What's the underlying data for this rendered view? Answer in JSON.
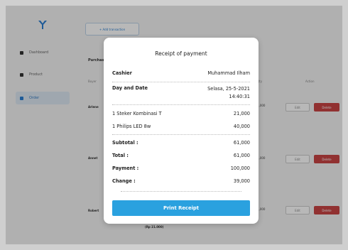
{
  "sidebar": {
    "items": [
      {
        "label": "Dashboard"
      },
      {
        "label": "Product"
      },
      {
        "label": "Order"
      }
    ]
  },
  "main": {
    "add_button": "+ Add transaction",
    "section_title": "Purchase",
    "columns": {
      "buyer": "Buyer",
      "qty": "Qty",
      "action": "Action"
    },
    "rows": [
      {
        "name": "Arlene",
        "price": "1,000"
      },
      {
        "name": "Annet",
        "price": "1,000"
      },
      {
        "name": "Robert",
        "price": "1,000"
      }
    ],
    "edit_label": "Edit",
    "delete_label": "Delete",
    "bottom_total": "(Rp 21.000)"
  },
  "receipt": {
    "title": "Receipt of payment",
    "cashier_label": "Cashier",
    "cashier_value": "Muhammad Ilham",
    "date_label": "Day and Date",
    "date_value": "Selasa, 25-5-2021",
    "time_value": "14:40:31",
    "items": [
      {
        "name": "1 Steker Kombinasi T",
        "price": "21,000"
      },
      {
        "name": "1 Philips LED 8w",
        "price": "40,000"
      }
    ],
    "subtotal_label": "Subtotal :",
    "subtotal_value": "61,000",
    "total_label": "Total :",
    "total_value": "61,000",
    "payment_label": "Payment :",
    "payment_value": "100,000",
    "change_label": "Change :",
    "change_value": "39,000",
    "print_button": "Print Receipt"
  },
  "colors": {
    "accent": "#2aa1df",
    "delete": "#c94545",
    "logo": "#2b7fd1"
  }
}
